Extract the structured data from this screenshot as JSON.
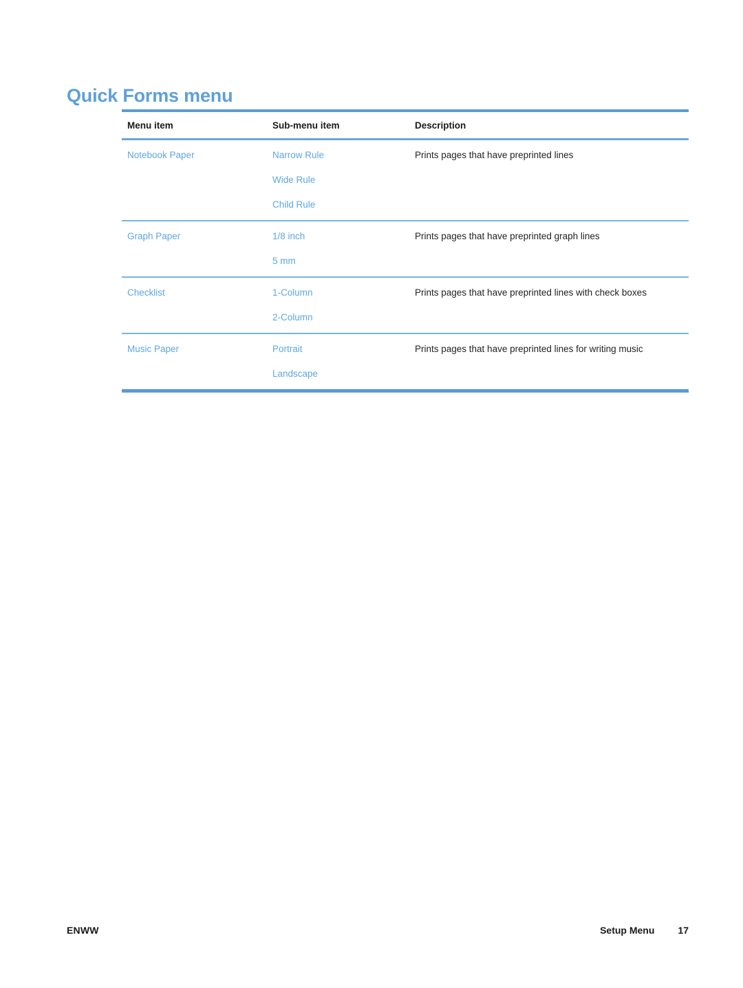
{
  "document": {
    "title": "Quick Forms menu"
  },
  "table": {
    "headers": {
      "menu_item": "Menu item",
      "sub_menu_item": "Sub-menu item",
      "description": "Description"
    },
    "groups": [
      {
        "menu_item": "Notebook Paper",
        "sub_items": [
          "Narrow Rule",
          "Wide Rule",
          "Child Rule"
        ],
        "description": "Prints pages that have preprinted lines"
      },
      {
        "menu_item": "Graph Paper",
        "sub_items": [
          "1/8 inch",
          "5 mm"
        ],
        "description": "Prints pages that have preprinted graph lines"
      },
      {
        "menu_item": "Checklist",
        "sub_items": [
          "1-Column",
          "2-Column"
        ],
        "description": "Prints pages that have preprinted lines with check boxes"
      },
      {
        "menu_item": "Music Paper",
        "sub_items": [
          "Portrait",
          "Landscape"
        ],
        "description": "Prints pages that have preprinted lines for writing music"
      }
    ]
  },
  "footer": {
    "left": "ENWW",
    "section": "Setup Menu",
    "page_number": "17"
  },
  "colors": {
    "heading_blue": "#5ea0d8",
    "link_blue": "#5fa6dd",
    "rule_blue": "#5b9bd5",
    "rule_thin_blue": "#74b6e2",
    "body_text": "#221f1f"
  }
}
